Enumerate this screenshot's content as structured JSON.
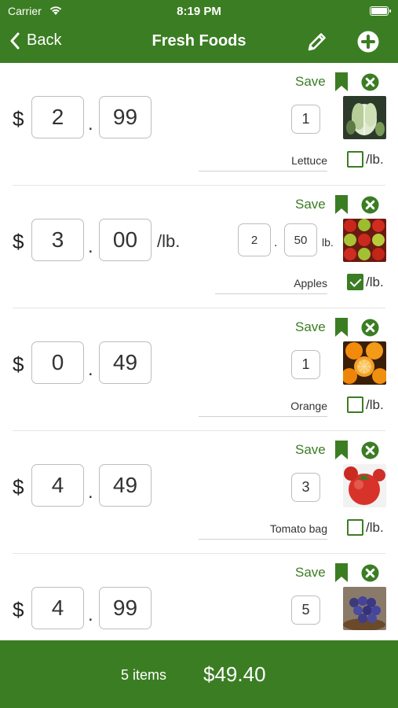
{
  "status_bar": {
    "carrier": "Carrier",
    "time": "8:19 PM"
  },
  "nav": {
    "back_label": "Back",
    "title": "Fresh Foods"
  },
  "items": [
    {
      "dollars": "2",
      "cents": "99",
      "per_lb_suffix": "",
      "quantity": "1",
      "name": "Lettuce",
      "per_lb": false,
      "lb_label": "/lb.",
      "save_label": "Save",
      "image": "lettuce-photo"
    },
    {
      "dollars": "3",
      "cents": "00",
      "per_lb_suffix": "/lb.",
      "weight_whole": "2",
      "weight_fraction": "50",
      "weight_unit": "lb.",
      "name": "Apples",
      "per_lb": true,
      "lb_label": "/lb.",
      "save_label": "Save",
      "image": "apples-photo"
    },
    {
      "dollars": "0",
      "cents": "49",
      "per_lb_suffix": "",
      "quantity": "1",
      "name": "Orange",
      "per_lb": false,
      "lb_label": "/lb.",
      "save_label": "Save",
      "image": "orange-photo"
    },
    {
      "dollars": "4",
      "cents": "49",
      "per_lb_suffix": "",
      "quantity": "3",
      "name": "Tomato bag",
      "per_lb": false,
      "lb_label": "/lb.",
      "save_label": "Save",
      "image": "tomato-photo"
    },
    {
      "dollars": "4",
      "cents": "99",
      "per_lb_suffix": "",
      "quantity": "5",
      "name": "",
      "per_lb": false,
      "lb_label": "/lb.",
      "save_label": "Save",
      "image": "grapes-photo"
    }
  ],
  "currency_symbol": "$",
  "decimal_separator": ".",
  "footer": {
    "item_count": "5 items",
    "total": "$49.40"
  },
  "colors": {
    "brand_green": "#3b7d23"
  }
}
